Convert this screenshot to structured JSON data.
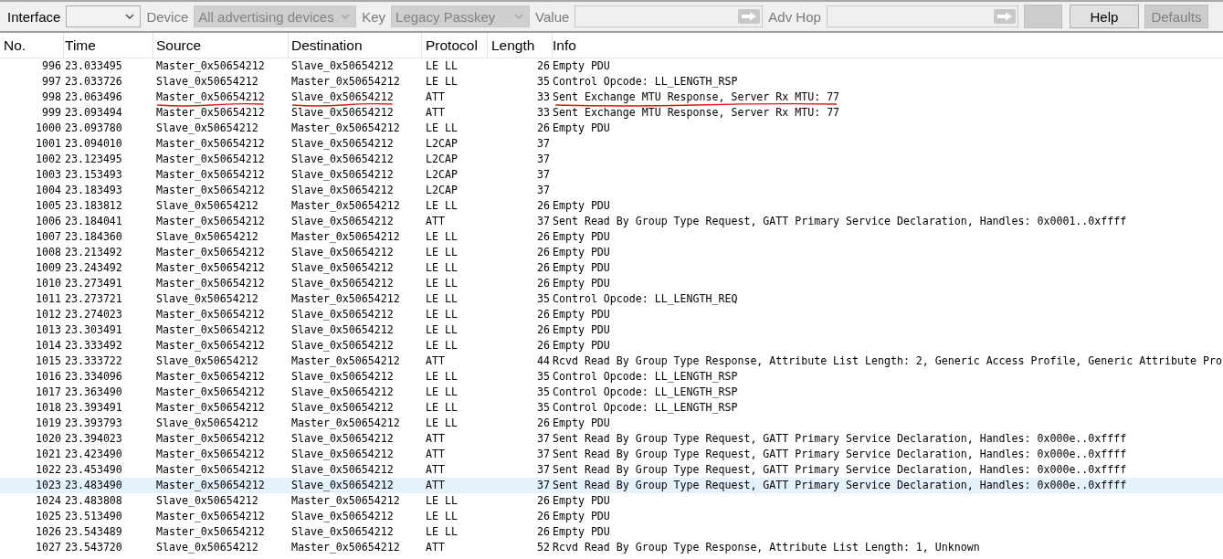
{
  "toolbar": [
    {
      "kind": "select",
      "label": "Interface",
      "disabled": false
    },
    {
      "kind": "select",
      "label": "Device",
      "value": "All advertising devices",
      "disabled": true
    },
    {
      "kind": "select",
      "label": "Key",
      "value": "Legacy Passkey",
      "disabled": true
    },
    {
      "kind": "field",
      "label": "Value",
      "disabled": true
    },
    {
      "kind": "field",
      "label": "Adv Hop",
      "disabled": true
    },
    {
      "kind": "button",
      "disabled": true
    },
    {
      "kind": "button",
      "text": "Help",
      "disabled": false
    },
    {
      "kind": "button",
      "text": "Defaults",
      "disabled": true
    }
  ],
  "table": {
    "columns": [
      "No.",
      "Time",
      "Source",
      "Destination",
      "Protocol",
      "Length",
      "Info"
    ],
    "rows": [
      {
        "no": "996",
        "time": "23.033495",
        "source": "Master_0x50654212",
        "destination": "Slave_0x50654212",
        "protocol": "LE LL",
        "length": "26",
        "info": "Empty PDU",
        "selected": false,
        "underlined": false
      },
      {
        "no": "997",
        "time": "23.033726",
        "source": "Slave_0x50654212",
        "destination": "Master_0x50654212",
        "protocol": "LE LL",
        "length": "35",
        "info": "Control Opcode: LL_LENGTH_RSP",
        "selected": false,
        "underlined": false
      },
      {
        "no": "998",
        "time": "23.063496",
        "source": "Master_0x50654212",
        "destination": "Slave_0x50654212",
        "protocol": "ATT",
        "length": "33",
        "info": "Sent Exchange MTU Response, Server Rx MTU: 77",
        "selected": false,
        "underlined": true
      },
      {
        "no": "999",
        "time": "23.093494",
        "source": "Master_0x50654212",
        "destination": "Slave_0x50654212",
        "protocol": "ATT",
        "length": "33",
        "info": "Sent Exchange MTU Response, Server Rx MTU: 77",
        "selected": false,
        "underlined": false
      },
      {
        "no": "1000",
        "time": "23.093780",
        "source": "Slave_0x50654212",
        "destination": "Master_0x50654212",
        "protocol": "LE LL",
        "length": "26",
        "info": "Empty PDU",
        "selected": false,
        "underlined": false
      },
      {
        "no": "1001",
        "time": "23.094010",
        "source": "Master_0x50654212",
        "destination": "Slave_0x50654212",
        "protocol": "L2CAP",
        "length": "37",
        "selected": false,
        "underlined": false
      },
      {
        "no": "1002",
        "time": "23.123495",
        "source": "Master_0x50654212",
        "destination": "Slave_0x50654212",
        "protocol": "L2CAP",
        "length": "37",
        "selected": false,
        "underlined": false
      },
      {
        "no": "1003",
        "time": "23.153493",
        "source": "Master_0x50654212",
        "destination": "Slave_0x50654212",
        "protocol": "L2CAP",
        "length": "37",
        "selected": false,
        "underlined": false
      },
      {
        "no": "1004",
        "time": "23.183493",
        "source": "Master_0x50654212",
        "destination": "Slave_0x50654212",
        "protocol": "L2CAP",
        "length": "37",
        "selected": false,
        "underlined": false
      },
      {
        "no": "1005",
        "time": "23.183812",
        "source": "Slave_0x50654212",
        "destination": "Master_0x50654212",
        "protocol": "LE LL",
        "length": "26",
        "info": "Empty PDU",
        "selected": false,
        "underlined": false
      },
      {
        "no": "1006",
        "time": "23.184041",
        "source": "Master_0x50654212",
        "destination": "Slave_0x50654212",
        "protocol": "ATT",
        "length": "37",
        "info": "Sent Read By Group Type Request, GATT Primary Service Declaration, Handles: 0x0001..0xffff",
        "selected": false,
        "underlined": false
      },
      {
        "no": "1007",
        "time": "23.184360",
        "source": "Slave_0x50654212",
        "destination": "Master_0x50654212",
        "protocol": "LE LL",
        "length": "26",
        "info": "Empty PDU",
        "selected": false,
        "underlined": false
      },
      {
        "no": "1008",
        "time": "23.213492",
        "source": "Master_0x50654212",
        "destination": "Slave_0x50654212",
        "protocol": "LE LL",
        "length": "26",
        "info": "Empty PDU",
        "selected": false,
        "underlined": false
      },
      {
        "no": "1009",
        "time": "23.243492",
        "source": "Master_0x50654212",
        "destination": "Slave_0x50654212",
        "protocol": "LE LL",
        "length": "26",
        "info": "Empty PDU",
        "selected": false,
        "underlined": false
      },
      {
        "no": "1010",
        "time": "23.273491",
        "source": "Master_0x50654212",
        "destination": "Slave_0x50654212",
        "protocol": "LE LL",
        "length": "26",
        "info": "Empty PDU",
        "selected": false,
        "underlined": false
      },
      {
        "no": "1011",
        "time": "23.273721",
        "source": "Slave_0x50654212",
        "destination": "Master_0x50654212",
        "protocol": "LE LL",
        "length": "35",
        "info": "Control Opcode: LL_LENGTH_REQ",
        "selected": false,
        "underlined": false
      },
      {
        "no": "1012",
        "time": "23.274023",
        "source": "Master_0x50654212",
        "destination": "Slave_0x50654212",
        "protocol": "LE LL",
        "length": "26",
        "info": "Empty PDU",
        "selected": false,
        "underlined": false
      },
      {
        "no": "1013",
        "time": "23.303491",
        "source": "Master_0x50654212",
        "destination": "Slave_0x50654212",
        "protocol": "LE LL",
        "length": "26",
        "info": "Empty PDU",
        "selected": false,
        "underlined": false
      },
      {
        "no": "1014",
        "time": "23.333492",
        "source": "Master_0x50654212",
        "destination": "Slave_0x50654212",
        "protocol": "LE LL",
        "length": "26",
        "info": "Empty PDU",
        "selected": false,
        "underlined": false
      },
      {
        "no": "1015",
        "time": "23.333722",
        "source": "Slave_0x50654212",
        "destination": "Master_0x50654212",
        "protocol": "ATT",
        "length": "44",
        "info": "Rcvd Read By Group Type Response, Attribute List Length: 2, Generic Access Profile, Generic Attribute Pro",
        "selected": false,
        "underlined": false
      },
      {
        "no": "1016",
        "time": "23.334096",
        "source": "Master_0x50654212",
        "destination": "Slave_0x50654212",
        "protocol": "LE LL",
        "length": "35",
        "info": "Control Opcode: LL_LENGTH_RSP",
        "selected": false,
        "underlined": false
      },
      {
        "no": "1017",
        "time": "23.363490",
        "source": "Master_0x50654212",
        "destination": "Slave_0x50654212",
        "protocol": "LE LL",
        "length": "35",
        "info": "Control Opcode: LL_LENGTH_RSP",
        "selected": false,
        "underlined": false
      },
      {
        "no": "1018",
        "time": "23.393491",
        "source": "Master_0x50654212",
        "destination": "Slave_0x50654212",
        "protocol": "LE LL",
        "length": "35",
        "info": "Control Opcode: LL_LENGTH_RSP",
        "selected": false,
        "underlined": false
      },
      {
        "no": "1019",
        "time": "23.393793",
        "source": "Slave_0x50654212",
        "destination": "Master_0x50654212",
        "protocol": "LE LL",
        "length": "26",
        "info": "Empty PDU",
        "selected": false,
        "underlined": false
      },
      {
        "no": "1020",
        "time": "23.394023",
        "source": "Master_0x50654212",
        "destination": "Slave_0x50654212",
        "protocol": "ATT",
        "length": "37",
        "info": "Sent Read By Group Type Request, GATT Primary Service Declaration, Handles: 0x000e..0xffff",
        "selected": false,
        "underlined": false
      },
      {
        "no": "1021",
        "time": "23.423490",
        "source": "Master_0x50654212",
        "destination": "Slave_0x50654212",
        "protocol": "ATT",
        "length": "37",
        "info": "Sent Read By Group Type Request, GATT Primary Service Declaration, Handles: 0x000e..0xffff",
        "selected": false,
        "underlined": false
      },
      {
        "no": "1022",
        "time": "23.453490",
        "source": "Master_0x50654212",
        "destination": "Slave_0x50654212",
        "protocol": "ATT",
        "length": "37",
        "info": "Sent Read By Group Type Request, GATT Primary Service Declaration, Handles: 0x000e..0xffff",
        "selected": false,
        "underlined": false
      },
      {
        "no": "1023",
        "time": "23.483490",
        "source": "Master_0x50654212",
        "destination": "Slave_0x50654212",
        "protocol": "ATT",
        "length": "37",
        "info": "Sent Read By Group Type Request, GATT Primary Service Declaration, Handles: 0x000e..0xffff",
        "selected": true,
        "underlined": false
      },
      {
        "no": "1024",
        "time": "23.483808",
        "source": "Slave_0x50654212",
        "destination": "Master_0x50654212",
        "protocol": "LE LL",
        "length": "26",
        "info": "Empty PDU",
        "selected": false,
        "underlined": false
      },
      {
        "no": "1025",
        "time": "23.513490",
        "source": "Master_0x50654212",
        "destination": "Slave_0x50654212",
        "protocol": "LE LL",
        "length": "26",
        "info": "Empty PDU",
        "selected": false,
        "underlined": false
      },
      {
        "no": "1026",
        "time": "23.543489",
        "source": "Master_0x50654212",
        "destination": "Slave_0x50654212",
        "protocol": "LE LL",
        "length": "26",
        "info": "Empty PDU",
        "selected": false,
        "underlined": false
      },
      {
        "no": "1027",
        "time": "23.543720",
        "source": "Slave_0x50654212",
        "destination": "Master_0x50654212",
        "protocol": "ATT",
        "length": "52",
        "info": "Rcvd Read By Group Type Response, Attribute List Length: 1, Unknown",
        "selected": false,
        "underlined": false
      }
    ]
  }
}
